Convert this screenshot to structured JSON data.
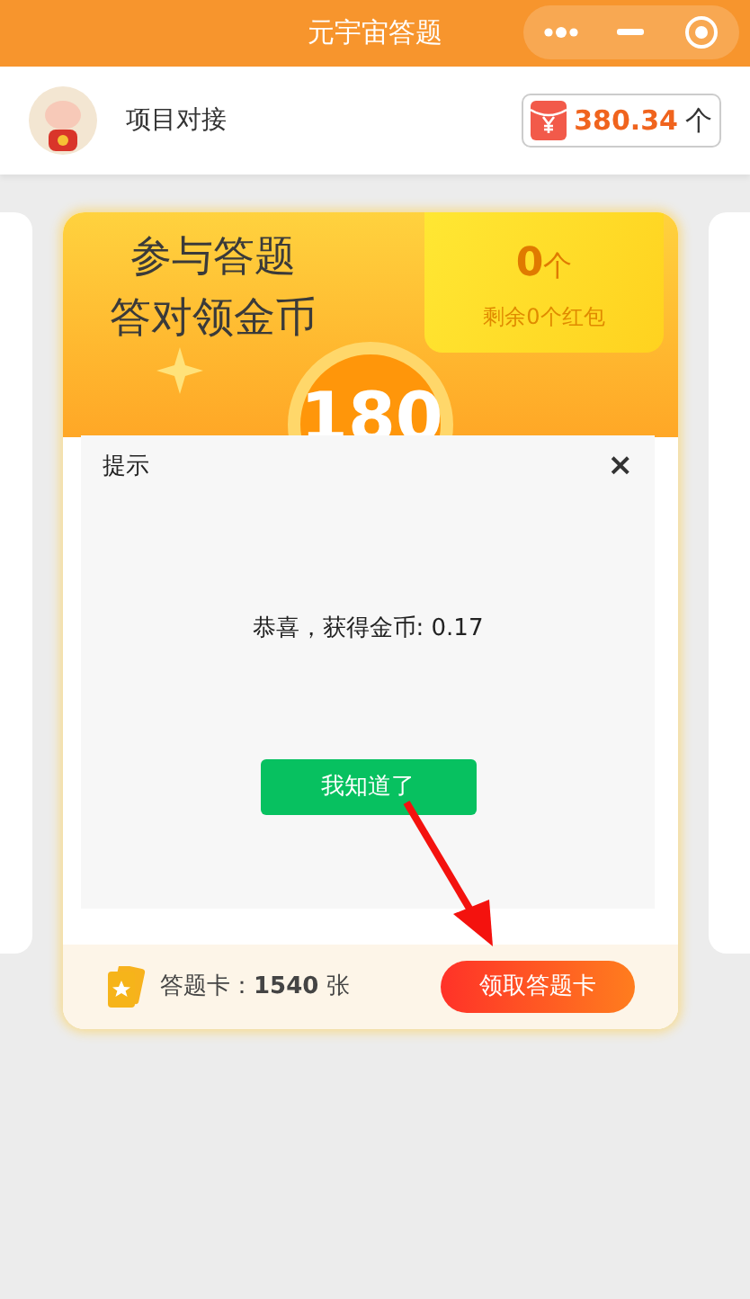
{
  "window": {
    "title": "元宇宙答题"
  },
  "header": {
    "username": "项目对接",
    "balance": "380.34",
    "unit": "个"
  },
  "card": {
    "title_lines": [
      "参与答题",
      "答对领金币"
    ],
    "packet_count": "0",
    "packet_unit": "个",
    "packet_remaining": "剩余0个红包",
    "score": "180",
    "cards_label": "答题卡：**1540** 张",
    "claim_button": "领取答题卡"
  },
  "dialog": {
    "title": "提示",
    "close": "×",
    "message": "恭喜，获得金币: 0.17",
    "ok_button": "我知道了"
  }
}
